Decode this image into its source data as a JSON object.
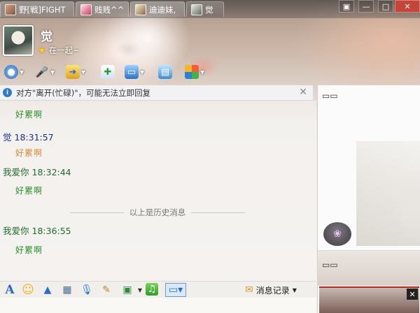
{
  "tabs": [
    {
      "label": "野[戦]FIGHT",
      "icon": "user-avatar-icon"
    },
    {
      "label": "贱贱^^",
      "icon": "user-avatar-icon"
    },
    {
      "label": "迪迪妹,",
      "icon": "user-avatar-icon"
    },
    {
      "label": "觉",
      "icon": "user-avatar-icon",
      "active": true
    }
  ],
  "window_controls": {
    "menu": "▣",
    "minimize": "—",
    "maximize": "□",
    "close": "✕"
  },
  "contact": {
    "name": "觉",
    "signature": "在一起~"
  },
  "toolbar_icons": [
    "video-call-icon",
    "voice-call-icon",
    "file-transfer-icon",
    "add-friend-icon",
    "remote-desktop-icon",
    "screen-share-icon",
    "apps-icon"
  ],
  "notice": {
    "text": "对方\"离开(忙碌)\"，可能无法立即回复",
    "close": "✕"
  },
  "messages": [
    {
      "sender": "",
      "time": "",
      "text": "好累啊",
      "self": false
    },
    {
      "sender": "觉",
      "time": "18:31:57",
      "text": "好累啊",
      "self": true
    },
    {
      "sender": "我爱你",
      "time": "18:32:44",
      "text": "好累啊",
      "self": false
    }
  ],
  "history_divider": "以上是历史消息",
  "latest_message": {
    "sender": "我爱你",
    "time": "18:36:55",
    "text": "好累啊"
  },
  "bottom_toolbar_icons": [
    "font-icon",
    "emoji-icon",
    "shake-icon",
    "gif-icon",
    "voice-message-icon",
    "note-icon",
    "image-icon",
    "music-icon",
    "screenshot-icon"
  ],
  "history_button": "消息记录",
  "colors": {
    "received_text": "#2a8f2a",
    "sent_text": "#d48a3a",
    "notice_icon": "#2f79c8"
  }
}
